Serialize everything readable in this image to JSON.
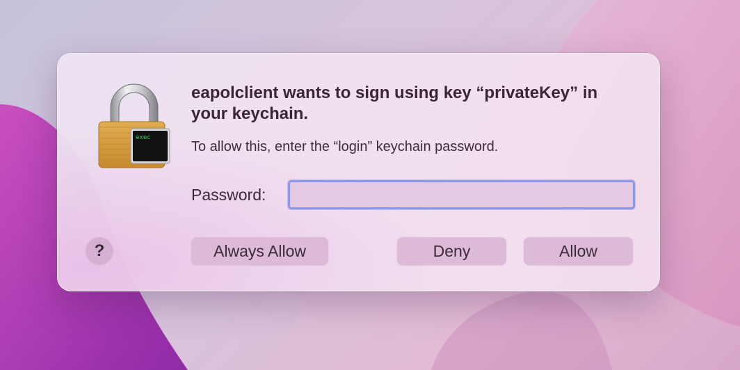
{
  "dialog": {
    "title": "eapolclient wants to sign using key “privateKey” in your keychain.",
    "message": "To allow this, enter the “login” keychain password.",
    "password_label": "Password:",
    "password_value": "",
    "password_placeholder": "",
    "lock_badge_text": "exec",
    "help_label": "?",
    "buttons": {
      "always_allow": "Always Allow",
      "deny": "Deny",
      "allow": "Allow"
    }
  },
  "colors": {
    "focus_ring": "#8e97e8",
    "button_bg": "#dcbad8",
    "title_text": "#3b2537"
  },
  "icons": {
    "lock": "padlock-with-terminal-icon",
    "help": "question-mark-icon"
  }
}
